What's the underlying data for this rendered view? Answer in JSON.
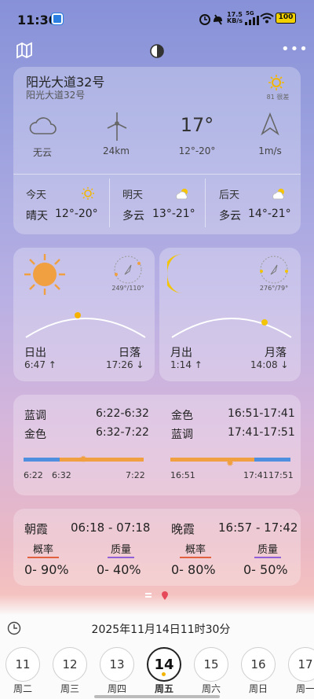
{
  "status": {
    "time": "11:30",
    "net_speed": "17.5",
    "net_unit": "KB/s",
    "signal": "5G",
    "battery": "100"
  },
  "location": {
    "name": "阳光大道32号",
    "sub": "阳光大道32号",
    "aqi": "81 很差"
  },
  "current": {
    "condition": "无云",
    "wind_distance": "24km",
    "temp": "17°",
    "temp_range": "12°-20°",
    "wind_speed": "1m/s"
  },
  "forecast": [
    {
      "day": "今天",
      "cond": "晴天",
      "range": "12°-20°"
    },
    {
      "day": "明天",
      "cond": "多云",
      "range": "13°-21°"
    },
    {
      "day": "后天",
      "cond": "多云",
      "range": "14°-21°"
    }
  ],
  "sun": {
    "azimuth": "249°/110°",
    "rise_label": "日出",
    "rise_time": "6:47",
    "set_label": "日落",
    "set_time": "17:26"
  },
  "moon": {
    "azimuth": "276°/79°",
    "rise_label": "月出",
    "rise_time": "1:14",
    "set_label": "月落",
    "set_time": "14:08"
  },
  "twilight": {
    "morning": [
      {
        "label": "蓝调",
        "time": "6:22-6:32"
      },
      {
        "label": "金色",
        "time": "6:32-7:22"
      }
    ],
    "evening": [
      {
        "label": "金色",
        "time": "16:51-17:41"
      },
      {
        "label": "蓝调",
        "time": "17:41-17:51"
      }
    ],
    "morning_ticks": [
      "6:22",
      "6:32",
      "7:22"
    ],
    "evening_ticks": [
      "16:51",
      "17:41",
      "17:51"
    ]
  },
  "glow": {
    "morning_label": "朝霞",
    "morning_time": "06:18 - 07:18",
    "evening_label": "晚霞",
    "evening_time": "16:57 - 17:42",
    "prob_label": "概率",
    "quality_label": "质量",
    "morning_prob": "0- 90%",
    "morning_quality": "0- 40%",
    "evening_prob": "0- 80%",
    "evening_quality": "0- 50%"
  },
  "datetime": "2025年11月14日11时30分",
  "days": [
    {
      "num": "11",
      "wd": "周二"
    },
    {
      "num": "12",
      "wd": "周三"
    },
    {
      "num": "13",
      "wd": "周四"
    },
    {
      "num": "14",
      "wd": "周五"
    },
    {
      "num": "15",
      "wd": "周六"
    },
    {
      "num": "16",
      "wd": "周日"
    },
    {
      "num": "17",
      "wd": "周一"
    }
  ],
  "colors": {
    "blue_hour": "#4f8fe0",
    "golden_hour": "#f0a040",
    "selected": "#f2b400"
  }
}
